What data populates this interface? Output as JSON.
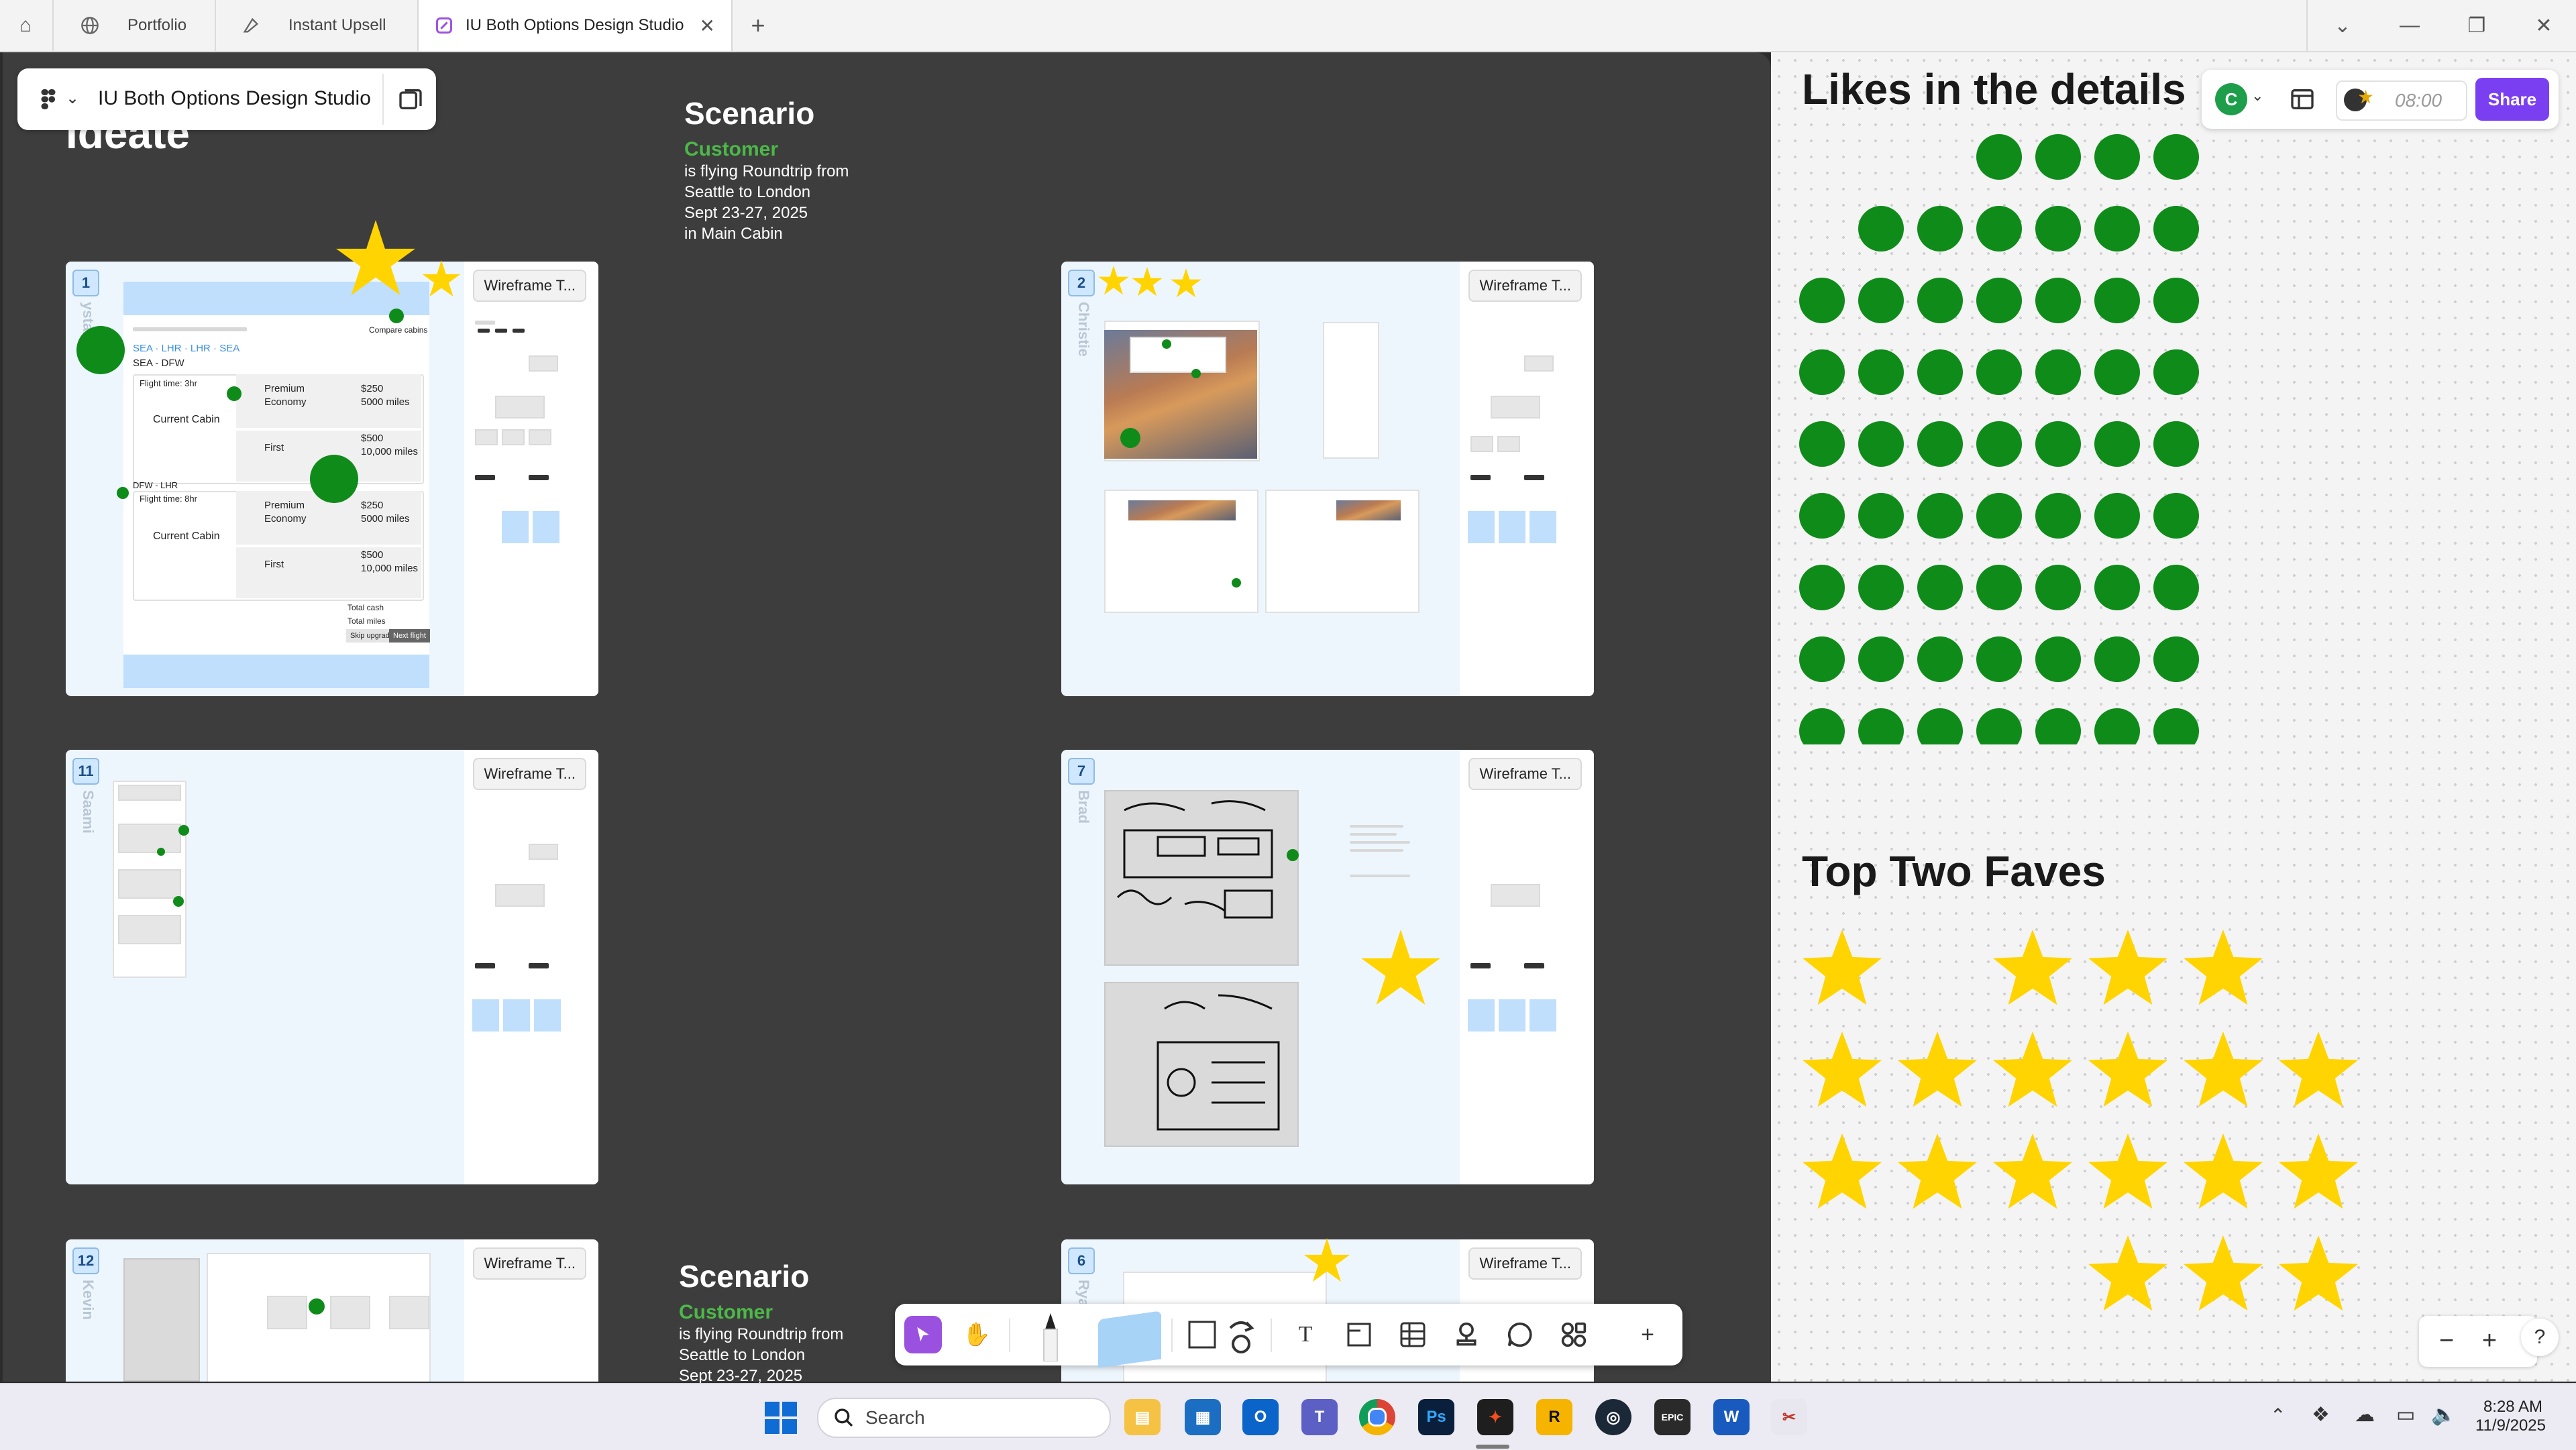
{
  "browser": {
    "tabs": [
      {
        "label": "Portfolio",
        "icon": "globe-icon"
      },
      {
        "label": "Instant Upsell",
        "icon": "figma-draw-icon"
      },
      {
        "label": "IU Both Options Design Studio",
        "icon": "figjam-icon",
        "active": true
      }
    ],
    "new_tab": "+",
    "window_controls": {
      "dropdown": "⌄",
      "minimize": "—",
      "restore": "❐",
      "close": "✕"
    }
  },
  "file": {
    "name": "IU Both Options Design Studio",
    "menu_icon": "figma-logo-icon"
  },
  "toolbar_right": {
    "avatar_initial": "C",
    "timer": "08:00",
    "share_label": "Share",
    "accent": "#7b3ff2"
  },
  "board": {
    "section_title": "Ideate",
    "scenario_top": {
      "heading": "Scenario",
      "customer": "Customer",
      "line1": "is flying Roundtrip from",
      "line2": "Seattle to London",
      "line3": "Sept 23-27, 2025",
      "line4": "in Main Cabin"
    },
    "scenario_bottom": {
      "heading": "Scenario",
      "customer": "Customer",
      "line1": "is flying Roundtrip from",
      "line2": "Seattle to London",
      "line3": "Sept 23-27, 2025"
    },
    "wireframe_label": "Wireframe T...",
    "cards": [
      {
        "number": "1",
        "name": "ystal"
      },
      {
        "number": "2",
        "name": "Christie"
      },
      {
        "number": "11",
        "name": "Saami"
      },
      {
        "number": "7",
        "name": "Brad"
      },
      {
        "number": "12",
        "name": "Kevin"
      },
      {
        "number": "6",
        "name": "Rya"
      }
    ],
    "card1": {
      "route1": "SEA - DFW",
      "flight1": "Flight time: 3hr",
      "route2": "DFW - LHR",
      "flight2": "Flight time: 8hr",
      "current_cabin": "Current Cabin",
      "premium_economy": "Premium\nEconomy",
      "premium_price": "$250\n5000 miles",
      "first": "First",
      "first_price": "$500\n10,000 miles",
      "compare": "Compare cabins",
      "total": "Total cash\nTotal miles",
      "skip": "Skip upgrade",
      "next": "Next flight"
    }
  },
  "likes": {
    "title": "Likes in the details",
    "dot_color": "#0f8b1a"
  },
  "faves": {
    "title": "Top Two Faves",
    "star_color": "#ffd400"
  },
  "zoom": {
    "minus": "−",
    "plus": "+",
    "help": "?"
  },
  "taskbar": {
    "search_placeholder": "Search",
    "time": "8:28 AM",
    "date": "11/9/2025",
    "apps": [
      "file-explorer-icon",
      "store-icon",
      "outlook-icon",
      "teams-icon",
      "chrome-icon",
      "photoshop-icon",
      "figma-icon",
      "rockstar-icon",
      "steam-icon",
      "epic-games-icon",
      "word-icon",
      "snipping-tool-icon"
    ]
  }
}
